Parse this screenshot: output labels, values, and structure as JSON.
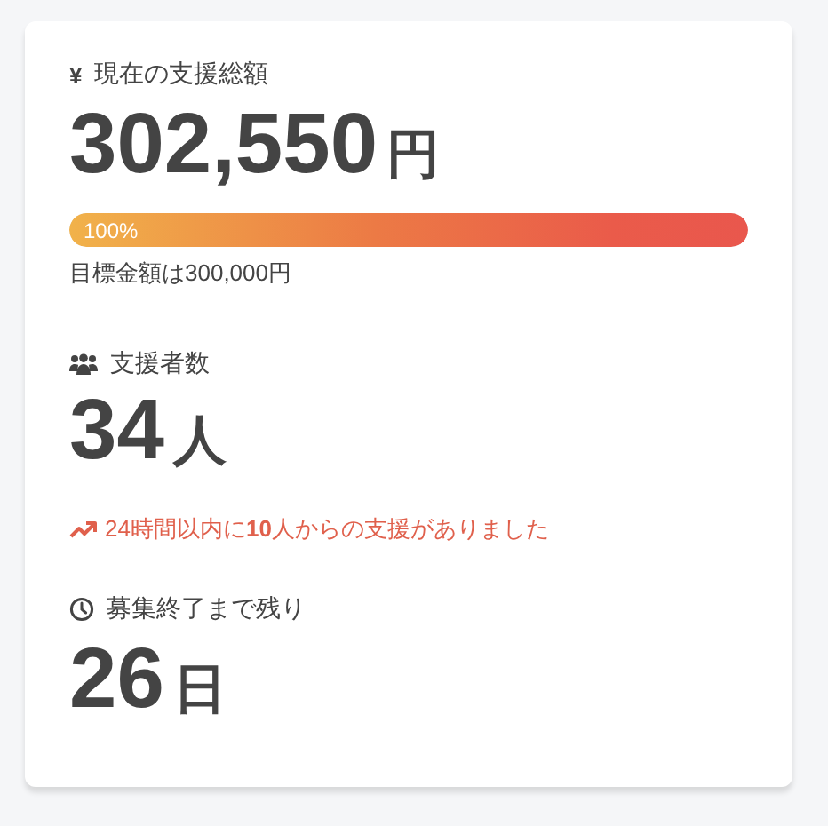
{
  "sections": [
    {
      "kind": "amount",
      "icon_text": "¥",
      "label": "現在の支援総額",
      "value": "302,550",
      "unit": "円",
      "progress": {
        "level": 1,
        "label": "100%"
      },
      "note": "目標金額は300,000円"
    },
    {
      "kind": "supporters",
      "label": "支援者数",
      "value": "34",
      "unit": "人",
      "trend": "24時間以内に**10**人からの支援がありました"
    },
    {
      "kind": "remaining",
      "label": "募集終了まで残り",
      "value": "26",
      "unit": "日"
    }
  ]
}
